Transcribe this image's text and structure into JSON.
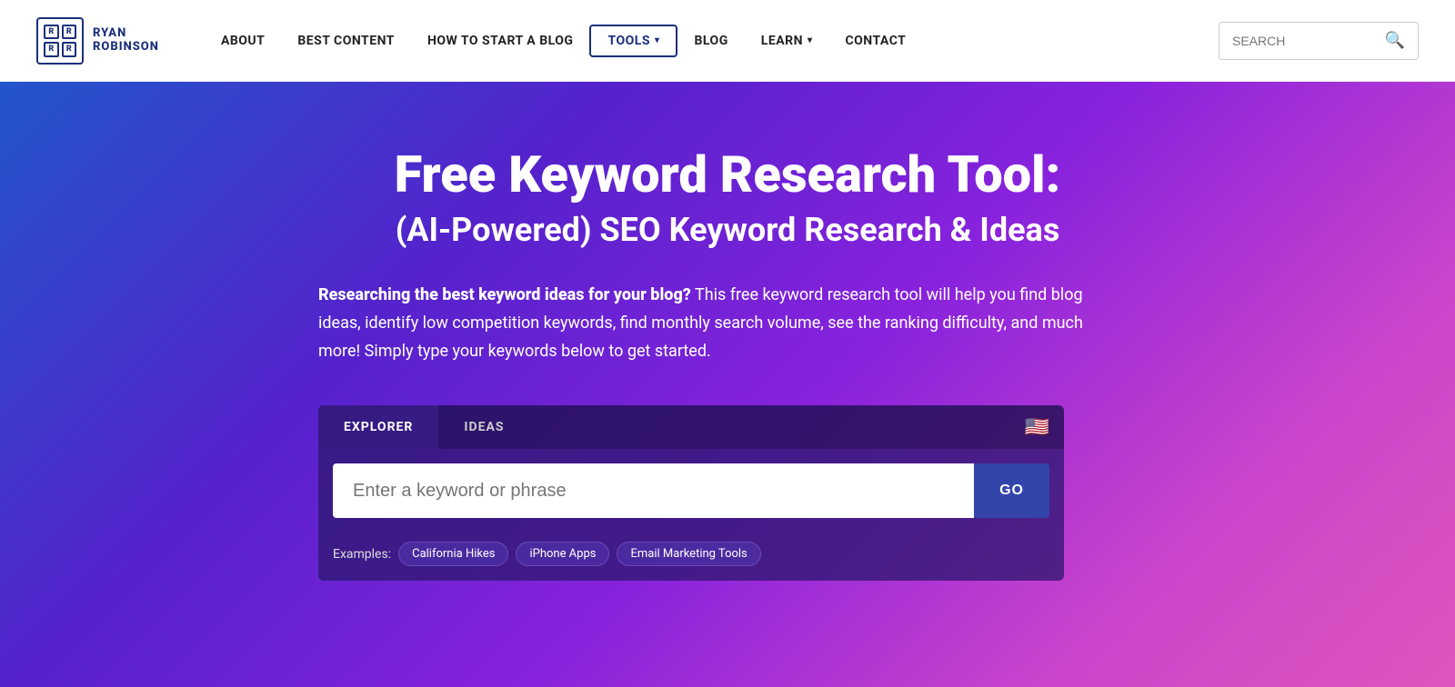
{
  "header": {
    "logo": {
      "top": "RYAN",
      "bottom": "ROBINSON",
      "grid": [
        "R",
        "R",
        "R",
        "R"
      ]
    },
    "nav": [
      {
        "label": "ABOUT",
        "active": false
      },
      {
        "label": "BEST CONTENT",
        "active": false
      },
      {
        "label": "HOW TO START A BLOG",
        "active": false
      },
      {
        "label": "TOOLS",
        "active": true,
        "hasChevron": true
      },
      {
        "label": "BLOG",
        "active": false
      },
      {
        "label": "LEARN",
        "active": false,
        "hasChevron": true
      },
      {
        "label": "CONTACT",
        "active": false
      }
    ],
    "search": {
      "placeholder": "SEARCH"
    }
  },
  "hero": {
    "title": "Free Keyword Research Tool:",
    "subtitle": "(AI-Powered) SEO Keyword Research & Ideas",
    "description_bold": "Researching the best keyword ideas for your blog?",
    "description_rest": " This free keyword research tool will help you find blog ideas, identify low competition keywords, find monthly search volume, see the ranking difficulty, and much more! Simply type your keywords below to get started.",
    "tabs": [
      {
        "label": "EXPLORER",
        "active": true
      },
      {
        "label": "IDEAS",
        "active": false
      }
    ],
    "flag": "🇺🇸",
    "search_placeholder": "Enter a keyword or phrase",
    "go_button": "GO",
    "examples_label": "Examples:",
    "examples": [
      "California Hikes",
      "iPhone Apps",
      "Email Marketing Tools"
    ]
  }
}
